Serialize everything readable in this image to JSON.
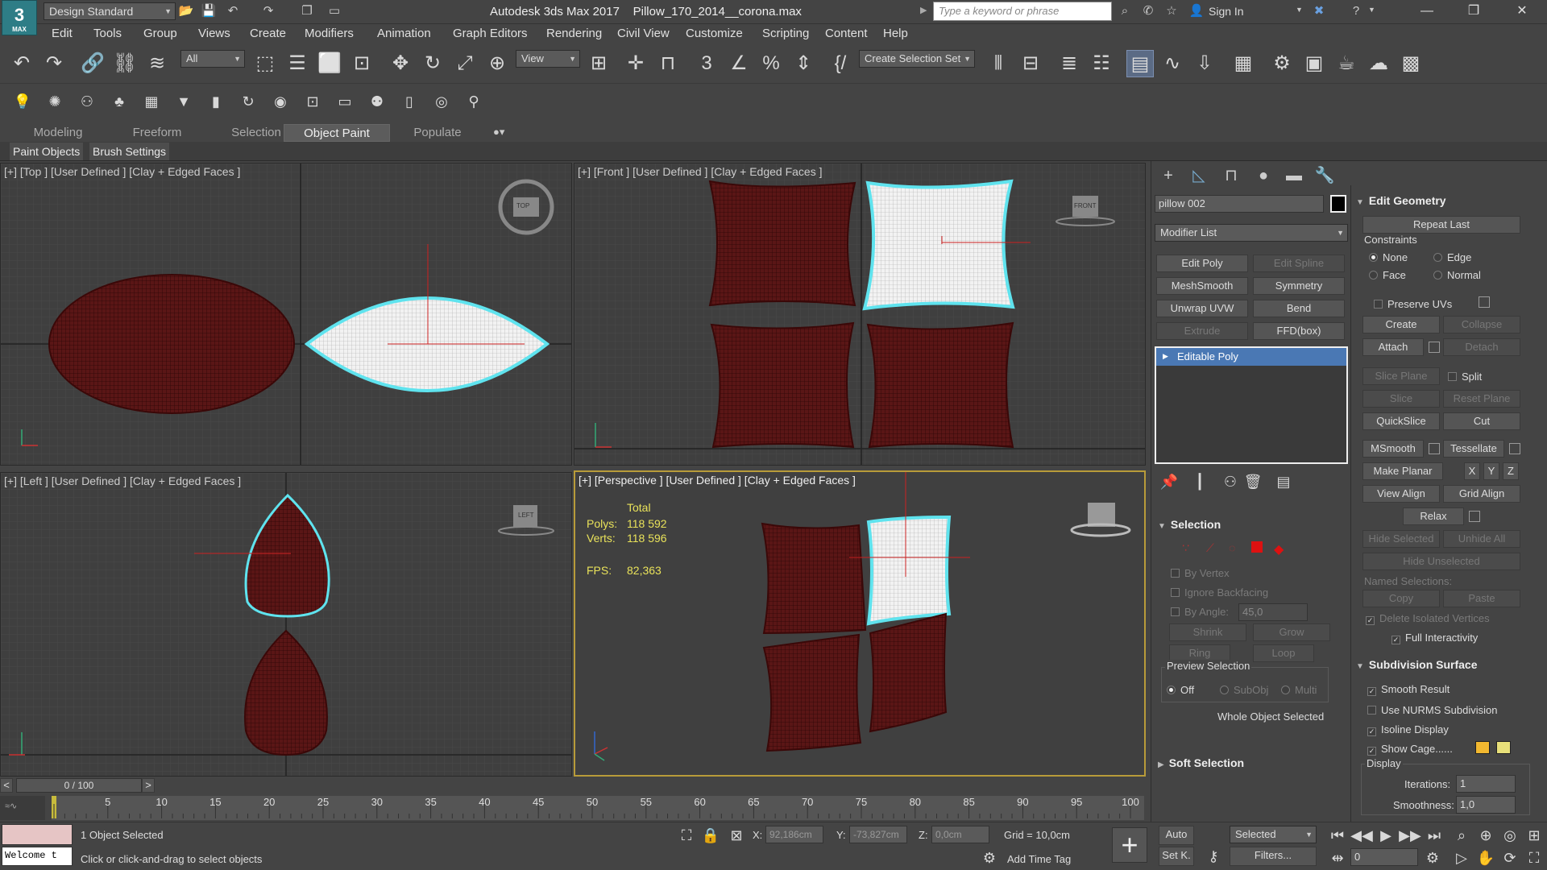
{
  "app": {
    "title": "Autodesk 3ds Max 2017",
    "file": "Pillow_170_2014__corona.max",
    "logo_number": "3",
    "logo_text": "MAX"
  },
  "workspace": {
    "value": "Design Standard"
  },
  "search": {
    "placeholder": "Type a keyword or phrase"
  },
  "account": {
    "signin": "Sign In"
  },
  "menus": [
    "Edit",
    "Tools",
    "Group",
    "Views",
    "Create",
    "Modifiers",
    "Animation",
    "Graph Editors",
    "Rendering",
    "Civil View",
    "Customize",
    "Scripting",
    "Content",
    "Help"
  ],
  "toolbar": {
    "filter": "All",
    "refcoord": "View",
    "selset": "Create Selection Set"
  },
  "ribbon": {
    "tabs": [
      "Modeling",
      "Freeform",
      "Selection",
      "Object Paint",
      "Populate"
    ],
    "active": "Object Paint",
    "subtabs": [
      "Paint Objects",
      "Brush Settings"
    ]
  },
  "viewports": {
    "top": {
      "label": "[+] [Top ] [User Defined ] [Clay + Edged Faces ]"
    },
    "front": {
      "label": "[+] [Front ] [User Defined ] [Clay + Edged Faces ]"
    },
    "left": {
      "label": "[+] [Left ] [User Defined ] [Clay + Edged Faces ]"
    },
    "perspective": {
      "label": "[+] [Perspective ] [User Defined ] [Clay + Edged Faces ]"
    },
    "stats": {
      "total": "Total",
      "polys_label": "Polys:",
      "polys": "118 592",
      "verts_label": "Verts:",
      "verts": "118 596",
      "fps_label": "FPS:",
      "fps": "82,363"
    },
    "cube_labels": {
      "top": "TOP",
      "front": "FRONT",
      "left": "LEFT"
    }
  },
  "command_panel": {
    "object_name": "pillow 002",
    "object_color": "#000000",
    "modifier_list": "Modifier List",
    "modifier_buttons": [
      {
        "label": "Edit Poly",
        "enabled": true
      },
      {
        "label": "Edit Spline",
        "enabled": false
      },
      {
        "label": "MeshSmooth",
        "enabled": true
      },
      {
        "label": "Symmetry",
        "enabled": true
      },
      {
        "label": "Unwrap UVW",
        "enabled": true
      },
      {
        "label": "Bend",
        "enabled": true
      },
      {
        "label": "Extrude",
        "enabled": false
      },
      {
        "label": "FFD(box)",
        "enabled": true
      }
    ],
    "stack": [
      "Editable Poly"
    ],
    "selection": {
      "title": "Selection",
      "by_vertex": "By Vertex",
      "ignore_backfacing": "Ignore Backfacing",
      "by_angle": "By Angle:",
      "angle": "45,0",
      "shrink": "Shrink",
      "grow": "Grow",
      "ring": "Ring",
      "loop": "Loop",
      "preview": "Preview Selection",
      "preview_opts": [
        "Off",
        "SubObj",
        "Multi"
      ],
      "status": "Whole Object Selected"
    },
    "soft_selection": "Soft Selection"
  },
  "edit_geometry": {
    "title": "Edit Geometry",
    "repeat_last": "Repeat Last",
    "constraints": "Constraints",
    "constraint_opts": [
      "None",
      "Edge",
      "Face",
      "Normal"
    ],
    "preserve_uvs": "Preserve UVs",
    "create": "Create",
    "collapse": "Collapse",
    "attach": "Attach",
    "detach": "Detach",
    "slice_plane": "Slice Plane",
    "split": "Split",
    "slice": "Slice",
    "reset_plane": "Reset Plane",
    "quickslice": "QuickSlice",
    "cut": "Cut",
    "msmooth": "MSmooth",
    "tessellate": "Tessellate",
    "make_planar": "Make Planar",
    "x": "X",
    "y": "Y",
    "z": "Z",
    "view_align": "View Align",
    "grid_align": "Grid Align",
    "relax": "Relax",
    "hide_selected": "Hide Selected",
    "unhide_all": "Unhide All",
    "hide_unselected": "Hide Unselected",
    "named_selections": "Named Selections:",
    "copy": "Copy",
    "paste": "Paste",
    "delete_isolated": "Delete Isolated Vertices",
    "full_interactivity": "Full Interactivity",
    "subdiv_title": "Subdivision Surface",
    "smooth_result": "Smooth Result",
    "use_nurms": "Use NURMS Subdivision",
    "isoline": "Isoline Display",
    "show_cage": "Show Cage......",
    "cage_color1": "#f2b830",
    "cage_color2": "#e8e07a",
    "display": "Display",
    "iterations_label": "Iterations:",
    "iterations": "1",
    "smoothness_label": "Smoothness:",
    "smoothness": "1,0"
  },
  "timeline": {
    "frame": "0 / 100",
    "ticks": [
      "5",
      "10",
      "15",
      "20",
      "25",
      "30",
      "35",
      "40",
      "45",
      "50",
      "55",
      "60",
      "65",
      "70",
      "75",
      "80",
      "85",
      "90",
      "95",
      "100"
    ]
  },
  "status": {
    "listener": "Welcome t",
    "selected": "1 Object Selected",
    "prompt": "Click or click-and-drag to select objects",
    "x_label": "X:",
    "x": "92,186cm",
    "y_label": "Y:",
    "y": "-73,827cm",
    "z_label": "Z:",
    "z": "0,0cm",
    "grid": "Grid = 10,0cm",
    "add_time_tag": "Add Time Tag",
    "auto": "Auto",
    "set_key": "Set K.",
    "key_filter": "Selected",
    "filters": "Filters...",
    "current_frame": "0"
  }
}
